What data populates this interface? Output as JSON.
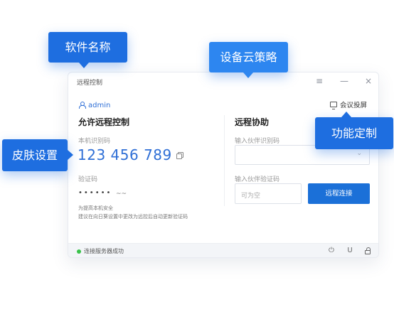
{
  "window": {
    "title": "远程控制",
    "menu_icon": "≡",
    "minimize_icon": "—",
    "close_icon": "×"
  },
  "user": {
    "name": "admin"
  },
  "left": {
    "title": "允许远程控制",
    "device_id_label": "本机识别码",
    "device_id": "123 456 789",
    "password_label": "验证码",
    "password_mask": "••••••",
    "eye_glyph": "~~",
    "note_line1": "为提高本机安全",
    "note_line2": "建议在向日葵设置中更改为远控后自动更新验证码"
  },
  "right": {
    "meeting_label": "会议投屏",
    "title": "远程协助",
    "partner_id_label": "输入伙伴识别码",
    "partner_id_value": "",
    "partner_code_label": "输入伙伴验证码",
    "partner_code_placeholder": "可为空",
    "connect_label": "远程连接"
  },
  "status": {
    "text": "连接服务器成功",
    "color": "#39c24a",
    "power_icon": "⏻",
    "u_icon": "U"
  },
  "callouts": {
    "software_name": "软件名称",
    "device_cloud_policy": "设备云策略",
    "skin_settings": "皮肤设置",
    "custom_features": "功能定制"
  },
  "colors": {
    "accent": "#1b70d8",
    "callout": "#1e6ee0",
    "link": "#2f6fd6"
  }
}
